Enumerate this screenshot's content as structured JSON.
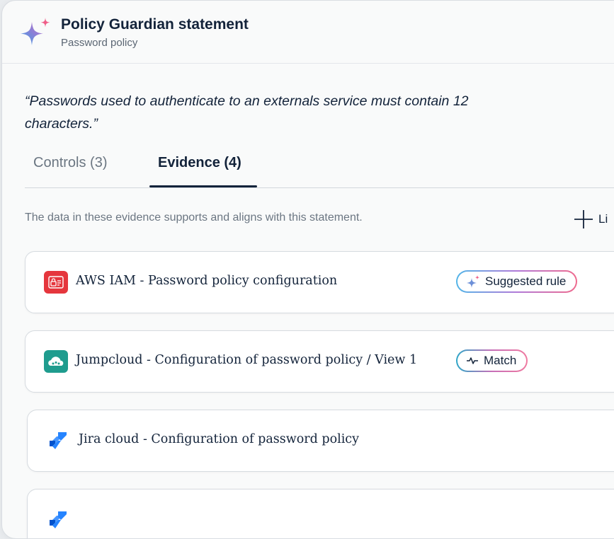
{
  "header": {
    "title": "Policy Guardian statement",
    "subtitle": "Password policy"
  },
  "statement": "“Passwords used to authenticate to an externals service must contain 12 characters.”",
  "tabs": [
    {
      "label": "Controls (3)",
      "active": false
    },
    {
      "label": "Evidence (4)",
      "active": true
    }
  ],
  "evidence": {
    "hint": "The data in these evidence supports and aligns with this statement.",
    "link_label": "Li",
    "items": [
      {
        "title": "AWS IAM - Password policy configuration",
        "icon": "aws-iam-icon",
        "badge": "Suggested rule"
      },
      {
        "title": "Jumpcloud - Configuration of password policy / View 1",
        "icon": "jumpcloud-icon",
        "badge": "Match"
      },
      {
        "title": "Jira cloud - Configuration of password policy",
        "icon": "jira-icon",
        "badge": ""
      },
      {
        "title": "",
        "icon": "jira-icon",
        "badge": ""
      }
    ]
  },
  "colors": {
    "accent": "#13233a",
    "aws": "#e5363d",
    "jumpcloud": "#1f9c8e",
    "jira": "#2684ff"
  }
}
